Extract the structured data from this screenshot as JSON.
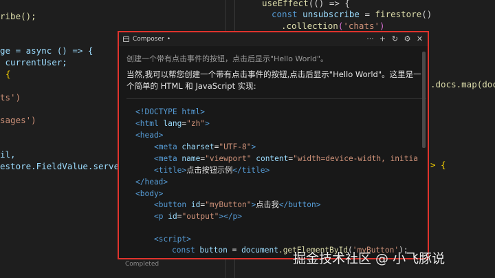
{
  "left_editor": {
    "lines": [
      "ribe();",
      "ge = async () => {",
      " currentUser;",
      "{",
      "ts')",
      "sages')",
      "il,",
      "estore.FieldValue.serverT"
    ]
  },
  "right_editor": {
    "line1": {
      "fn": "useEffect",
      "rest": "(() => {"
    },
    "line2": {
      "kw": "const",
      "var": " unsubscribe",
      "op": " = ",
      "fn": "firestore",
      "end": "()"
    },
    "line3": {
      "method": ".collection",
      "open": "(",
      "str": "'chats'",
      "close": ")"
    },
    "line4": ".docs.map(doc",
    "line5": "> {"
  },
  "composer": {
    "tab_title": "Composer",
    "modified_marker": "•",
    "actions": {
      "more": "···",
      "new": "+",
      "history": "↻",
      "settings": "⚙",
      "close": "✕"
    },
    "user_message": "创建一个带有点击事件的按钮，点击后显示\"Hello World\"。",
    "assistant_message": "当然,我可以帮您创建一个带有点击事件的按钮,点击后显示\"Hello World\"。这里是一个简单的 HTML 和 JavaScript 实现:",
    "code": {
      "l1": {
        "a": "<!DOCTYPE html>"
      },
      "l2": {
        "a": "<html ",
        "b": "lang",
        "c": "=",
        "d": "\"zh\"",
        "e": ">"
      },
      "l3": {
        "a": "<head>"
      },
      "l4": {
        "a": "<meta ",
        "b": "charset",
        "c": "=",
        "d": "\"UTF-8\"",
        "e": ">"
      },
      "l5": {
        "a": "<meta ",
        "b": "name",
        "c": "=",
        "d": "\"viewport\"",
        "f": " content",
        "g": "=",
        "h": "\"width=device-width, initia"
      },
      "l6": {
        "a": "<title>",
        "t": "点击按钮示例",
        "e": "</title>"
      },
      "l7": {
        "a": "</head>"
      },
      "l8": {
        "a": "<body>"
      },
      "l9": {
        "a": "<button ",
        "b": "id",
        "c": "=",
        "d": "\"myButton\"",
        "e": ">",
        "t": "点击我",
        "f": "</button>"
      },
      "l10": {
        "a": "<p ",
        "b": "id",
        "c": "=",
        "d": "\"output\"",
        "e": "></p>"
      },
      "l11": {
        "a": "<script>"
      },
      "l12": {
        "kw": "const",
        "v": " button",
        "op": " = ",
        "obj": "document",
        "m": ".getElementById",
        "p1": "(",
        "s": "'myButton'",
        "p2": ");"
      }
    }
  },
  "status_text": "Completed",
  "watermark": "掘金技术社区 @ 小飞豚说"
}
